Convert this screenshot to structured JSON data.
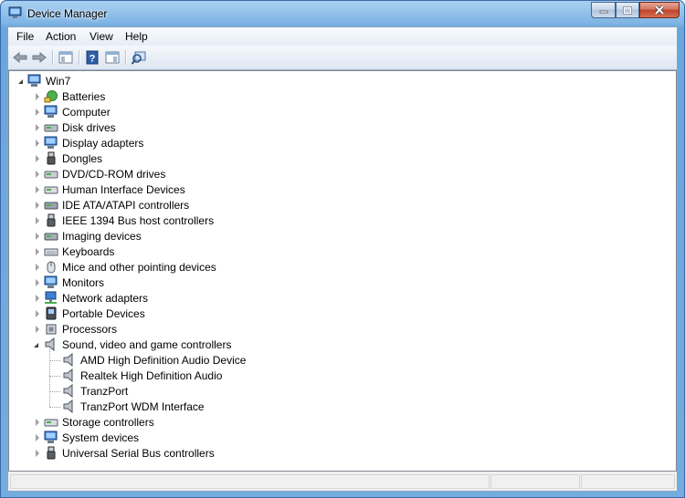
{
  "window": {
    "title": "Device Manager"
  },
  "menu": [
    "File",
    "Action",
    "View",
    "Help"
  ],
  "toolbar": {
    "icons": [
      "back-arrow-icon",
      "forward-arrow-icon",
      "show-hide-console-tree-icon",
      "help-icon",
      "properties-icon",
      "scan-hardware-icon"
    ]
  },
  "tree": {
    "root": "Win7",
    "categories": [
      {
        "label": "Batteries",
        "icon": "battery-icon"
      },
      {
        "label": "Computer",
        "icon": "computer-icon"
      },
      {
        "label": "Disk drives",
        "icon": "disk-drive-icon"
      },
      {
        "label": "Display adapters",
        "icon": "display-adapter-icon"
      },
      {
        "label": "Dongles",
        "icon": "dongle-icon"
      },
      {
        "label": "DVD/CD-ROM drives",
        "icon": "dvd-drive-icon"
      },
      {
        "label": "Human Interface Devices",
        "icon": "hid-icon"
      },
      {
        "label": "IDE ATA/ATAPI controllers",
        "icon": "ide-controller-icon"
      },
      {
        "label": "IEEE 1394 Bus host controllers",
        "icon": "ieee1394-icon"
      },
      {
        "label": "Imaging devices",
        "icon": "imaging-device-icon"
      },
      {
        "label": "Keyboards",
        "icon": "keyboard-icon"
      },
      {
        "label": "Mice and other pointing devices",
        "icon": "mouse-icon"
      },
      {
        "label": "Monitors",
        "icon": "monitor-icon"
      },
      {
        "label": "Network adapters",
        "icon": "network-adapter-icon"
      },
      {
        "label": "Portable Devices",
        "icon": "portable-device-icon"
      },
      {
        "label": "Processors",
        "icon": "processor-icon"
      },
      {
        "label": "Sound, video and game controllers",
        "icon": "speaker-icon",
        "expanded": true,
        "children": [
          "AMD High Definition Audio Device",
          "Realtek High Definition Audio",
          "TranzPort",
          "TranzPort WDM Interface"
        ]
      },
      {
        "label": "Storage controllers",
        "icon": "storage-controller-icon"
      },
      {
        "label": "System devices",
        "icon": "system-device-icon"
      },
      {
        "label": "Universal Serial Bus controllers",
        "icon": "usb-controller-icon"
      }
    ]
  }
}
